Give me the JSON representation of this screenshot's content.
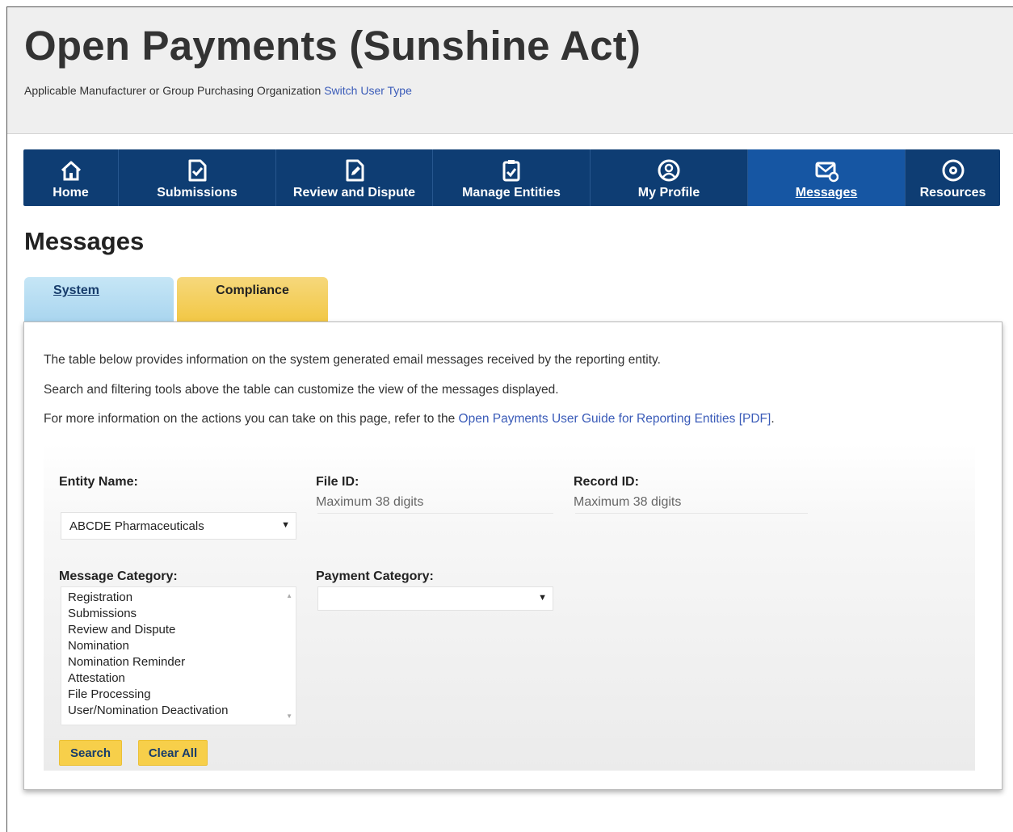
{
  "header": {
    "title": "Open Payments (Sunshine Act)",
    "subtitle": "Applicable Manufacturer or Group Purchasing Organization",
    "switch_link": "Switch User Type"
  },
  "nav": {
    "items": [
      {
        "label": "Home",
        "icon": "home-icon",
        "active": false
      },
      {
        "label": "Submissions",
        "icon": "document-check-icon",
        "active": false
      },
      {
        "label": "Review and Dispute",
        "icon": "document-edit-icon",
        "active": false
      },
      {
        "label": "Manage Entities",
        "icon": "clipboard-check-icon",
        "active": false
      },
      {
        "label": "My Profile",
        "icon": "user-circle-icon",
        "active": false
      },
      {
        "label": "Messages",
        "icon": "envelope-icon",
        "active": true
      },
      {
        "label": "Resources",
        "icon": "gear-icon",
        "active": false
      }
    ]
  },
  "page": {
    "title": "Messages"
  },
  "tabs": {
    "system": "System",
    "compliance": "Compliance"
  },
  "intro": {
    "line1": "The table below provides information on the system generated email messages received by the reporting entity.",
    "line2": "Search and filtering tools above the table can customize the view of the messages displayed.",
    "line3_prefix": "For more information on the actions you can take on this page, refer to the",
    "line3_link": "Open Payments User Guide for Reporting Entities [PDF]",
    "line3_suffix": "."
  },
  "filters": {
    "entity_name_label": "Entity Name:",
    "entity_name_value": "ABCDE Pharmaceuticals",
    "file_id_label": "File ID:",
    "file_id_hint": "Maximum 38 digits",
    "record_id_label": "Record ID:",
    "record_id_hint": "Maximum 38 digits",
    "message_category_label": "Message Category:",
    "message_categories": [
      "Registration",
      "Submissions",
      "Review and Dispute",
      "Nomination",
      "Nomination Reminder",
      "Attestation",
      "File Processing",
      "User/Nomination Deactivation"
    ],
    "payment_category_label": "Payment Category:",
    "payment_category_value": ""
  },
  "buttons": {
    "search": "Search",
    "clear_all": "Clear All"
  },
  "colors": {
    "nav_bg": "#0e3d73",
    "nav_active": "#1656a3",
    "link": "#3a5bb8",
    "button_yellow": "#f7cf4a",
    "tab_system": "#a9d5ef",
    "tab_compliance": "#f2c744"
  }
}
